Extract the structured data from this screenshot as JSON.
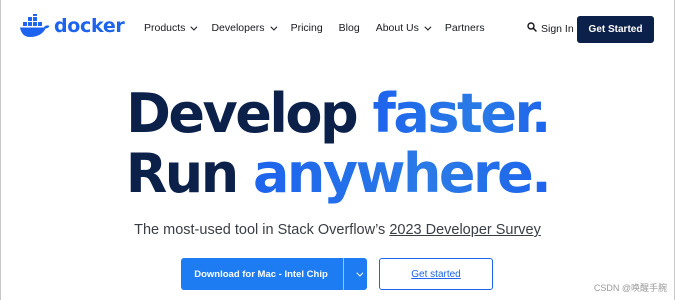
{
  "brand": {
    "name": "docker",
    "color": "#1d63ed"
  },
  "nav": {
    "items": [
      {
        "label": "Products",
        "dropdown": true
      },
      {
        "label": "Developers",
        "dropdown": true
      },
      {
        "label": "Pricing",
        "dropdown": false
      },
      {
        "label": "Blog",
        "dropdown": false
      },
      {
        "label": "About Us",
        "dropdown": true
      },
      {
        "label": "Partners",
        "dropdown": false
      }
    ],
    "sign_in": "Sign In",
    "get_started": "Get Started"
  },
  "hero": {
    "line1": {
      "word1": "Develop",
      "word2": "faster."
    },
    "line2": {
      "word1": "Run",
      "word2": "anywhere."
    },
    "subtitle_prefix": "The most-used tool in Stack Overflow’s ",
    "subtitle_link": "2023 Developer Survey",
    "primary_button": "Download for Mac - Intel Chip",
    "secondary_button": "Get started"
  },
  "watermark": "CSDN @唤醒手腕",
  "colors": {
    "navy": "#0b214a",
    "blue": "#1d63ed",
    "button_blue": "#1d7cf2"
  },
  "icons": {
    "logo": "docker-whale-icon",
    "search": "search-icon",
    "dropdown": "chevron-down-icon"
  }
}
